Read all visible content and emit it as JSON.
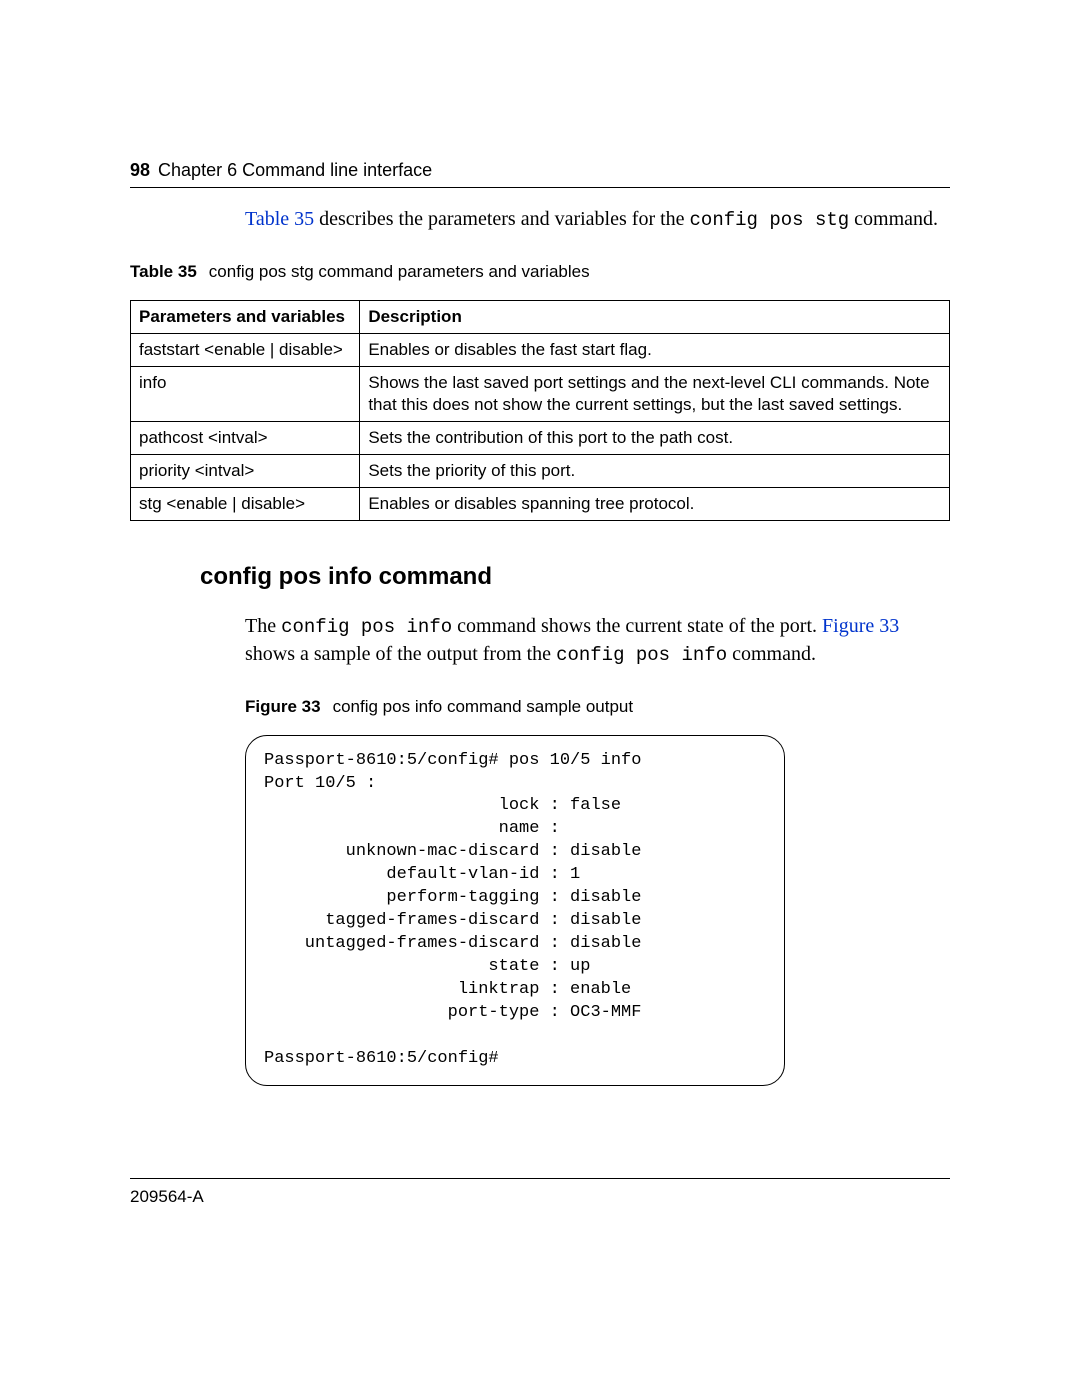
{
  "header": {
    "page_number": "98",
    "chapter": "Chapter 6  Command line interface"
  },
  "intro": {
    "ref": "Table 35",
    "after_ref": " describes the parameters and variables for the ",
    "code": "config pos stg",
    "tail": " command."
  },
  "table35": {
    "label": "Table 35",
    "caption": "config pos stg command parameters and variables",
    "head_param": "Parameters and variables",
    "head_desc": "Description",
    "rows": [
      {
        "param": "faststart <enable | disable>",
        "desc": "Enables or disables the fast start flag."
      },
      {
        "param": "info",
        "desc": "Shows the last saved port settings and the next-level CLI commands. Note that this does not show the current settings, but the last saved settings."
      },
      {
        "param": "pathcost <intval>",
        "desc": "Sets the contribution of this port to the path cost."
      },
      {
        "param": "priority <intval>",
        "desc": "Sets the priority of this port."
      },
      {
        "param": "stg <enable | disable>",
        "desc": "Enables or disables spanning tree protocol."
      }
    ]
  },
  "section_heading": "config pos info command",
  "intro2": {
    "pre": "The ",
    "code1": "config pos info",
    "mid": " command shows the current state of the port. ",
    "ref": "Figure 33",
    "after_ref": " shows a sample of the output from the ",
    "code2": "config pos info",
    "tail": " command."
  },
  "figure33": {
    "label": "Figure 33",
    "caption": "config pos info command sample output",
    "output": "Passport-8610:5/config# pos 10/5 info\nPort 10/5 :\n                       lock : false\n                       name :\n        unknown-mac-discard : disable\n            default-vlan-id : 1\n            perform-tagging : disable\n      tagged-frames-discard : disable\n    untagged-frames-discard : disable\n                      state : up\n                   linktrap : enable\n                  port-type : OC3-MMF\n\nPassport-8610:5/config#"
  },
  "footer": {
    "doc_id": "209564-A"
  }
}
